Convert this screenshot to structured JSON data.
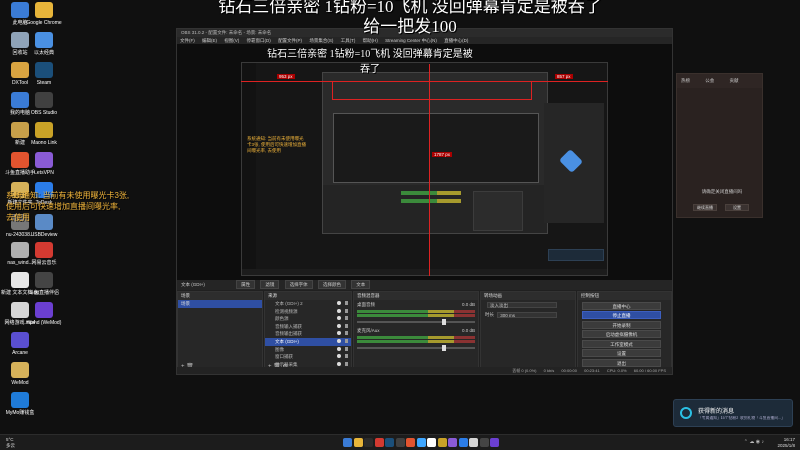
{
  "overlay": {
    "title_line1": "钻石三倍亲密 1钻粉=10飞机  没回弹幕肯定是被吞了",
    "title_line2": "给一把发100"
  },
  "desktop_icons": [
    {
      "label": "此电脑",
      "color": "#3a7bd5"
    },
    {
      "label": "Google Chrome",
      "color": "#e8b53a"
    },
    {
      "label": "回收站",
      "color": "#8fa3b8"
    },
    {
      "label": "以太经典",
      "color": "#4a90e2"
    },
    {
      "label": "DXTool",
      "color": "#d9a441"
    },
    {
      "label": "Steam",
      "color": "#1b4f7a"
    },
    {
      "label": "我的电脑",
      "color": "#3a7bd5"
    },
    {
      "label": "OBS Studio",
      "color": "#404040"
    },
    {
      "label": "新建",
      "color": "#c8a04a"
    },
    {
      "label": "Maono Link",
      "color": "#c9a227"
    },
    {
      "label": "斗鱼直播助手",
      "color": "#e2542f"
    },
    {
      "label": "LetsVPN",
      "color": "#8a5bd6"
    },
    {
      "label": "新建文件夹",
      "color": "#d6b25a"
    },
    {
      "label": "ToDesk",
      "color": "#2b7de9"
    },
    {
      "label": "nu-243038...",
      "color": "#777"
    },
    {
      "label": "USBDeview",
      "color": "#5a8ac6"
    },
    {
      "label": "nas_wind...",
      "color": "#b0b0b0"
    },
    {
      "label": "网易云音乐",
      "color": "#d33a31"
    },
    {
      "label": "新建 文本文档.txt",
      "color": "#e8e8e8"
    },
    {
      "label": "斗鱼直播伴侣",
      "color": "#444"
    },
    {
      "label": "网络游戏.mp4",
      "color": "#d6d6d6"
    },
    {
      "label": "Wand (WeMod)",
      "color": "#6b3fd1"
    },
    {
      "label": "Arcane",
      "color": "#5a4fd1"
    },
    {
      "label": "WeMod",
      "color": "#d6b25a"
    },
    {
      "label": "MyMo赚钱盒",
      "color": "#1f7bd8"
    }
  ],
  "system_notice": "系统通知:  当前有未使用曝光卡3张,  使用后可快速增加直播间曝光率,  去使用",
  "obs": {
    "window_title": "OBS 31.0.2 - 配置文件: 未命名 - 场景: 未命名",
    "menu": [
      "文件(F)",
      "编辑(E)",
      "视图(V)",
      "停靠窗口(D)",
      "配置文件(P)",
      "场景集合(S)",
      "工具(T)",
      "帮助(H)",
      "Streaming Center 中心(N)",
      "直播中心(D)"
    ],
    "preview": {
      "inner_title": "钻石三倍亲密 1钻粉=10飞机  没回弹幕肯定是被吞了",
      "label_left": "953 px",
      "label_right": "857 px",
      "label_inner": "1787 px",
      "inner_notice": "系统通知: 当前有未使用曝光卡3张, 使用后可快速增加直播间曝光率, 去使用"
    },
    "toolbar": {
      "source_name": "文本 (GDI+)",
      "buttons": [
        "属性",
        "滤镜",
        "选择字体",
        "选择颜色",
        "文本"
      ]
    },
    "scenes": {
      "title": "场景",
      "items": [
        "场景"
      ]
    },
    "sources": {
      "title": "来源",
      "items": [
        "文本 (GDI+) 2",
        "检测视频源",
        "颜色源",
        "音频输入捕获",
        "音频输出捕获",
        "文本 (GDI+)",
        "图像",
        "窗口捕获",
        "显示器采集",
        "视频采集设备"
      ],
      "selected": 5
    },
    "mixer": {
      "title": "音频混音器",
      "channels": [
        {
          "name": "桌面音频",
          "level": "0.0 dB"
        },
        {
          "name": "麦克风/Aux",
          "level": "0.0 dB"
        }
      ]
    },
    "transitions": {
      "title": "转场动画",
      "type": "淡入淡出",
      "duration_label": "时长",
      "duration": "300 ms"
    },
    "controls": {
      "title": "控制按钮",
      "buttons": [
        "直播中心",
        "停止直播",
        "开始录制",
        "启动虚拟摄像机",
        "工作室模式",
        "设置",
        "退出"
      ],
      "active": 1
    },
    "status": {
      "frames": "丢帧 0 (0.0%)",
      "bitrate": "0 kb/s",
      "rec_time": "00:00:00",
      "live_time": "00:23:41",
      "cpu": "CPU: 0.0%",
      "fps": "60.00 / 60.00 FPS"
    }
  },
  "right_dialog": {
    "tabs": [
      "热榜",
      "公会",
      "贡献"
    ],
    "message": "请确定关闭直播间吗",
    "buttons": [
      "继续直播",
      "设置"
    ]
  },
  "notification": {
    "title": "获得新的消息",
    "body": "「专属通知」【5个钻粉】收到礼物「斗鱼直播间...」"
  },
  "taskbar": {
    "weather_temp": "5°C",
    "weather_desc": "多云",
    "time": "16:17",
    "date": "2025/1/8",
    "apps": [
      "#3a7bd5",
      "#e8b53a",
      "#2b2b2b",
      "#d33a31",
      "#1b4f7a",
      "#404040",
      "#e2542f",
      "#3ea6ff",
      "#ffffff",
      "#c9a227",
      "#8a5bd6",
      "#2b7de9",
      "#d6d6d6",
      "#444",
      "#6b3fd1"
    ]
  }
}
